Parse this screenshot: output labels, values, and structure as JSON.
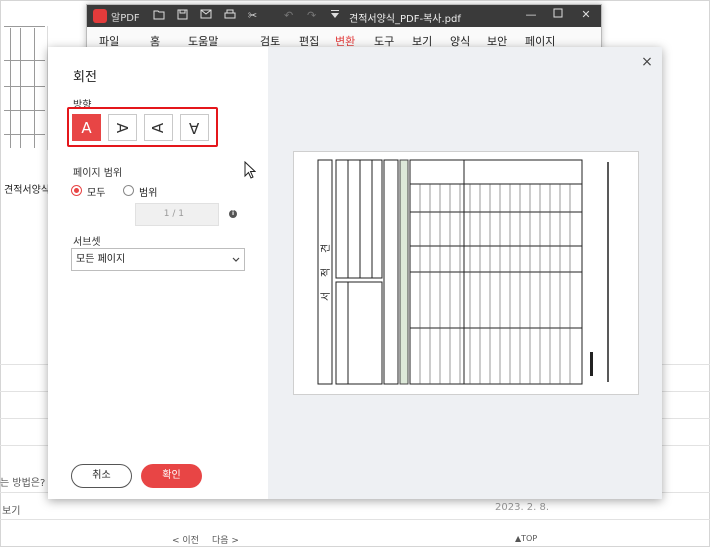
{
  "background": {
    "doc_title": "견적서양식_",
    "question": "는 방법은?",
    "view_label": "보기",
    "date": "2023. 2. 8.",
    "prev_label": "< 이전",
    "next_label": "다음 >",
    "top_label": "▲TOP"
  },
  "app": {
    "name": "알PDF",
    "document_title": "견적서양식_PDF-복사.pdf",
    "menu": [
      "파일",
      "홈",
      "도움말",
      "검토",
      "편집",
      "변환",
      "도구",
      "보기",
      "양식",
      "보안",
      "페이지"
    ],
    "active_menu": "변환"
  },
  "dialog": {
    "title": "회전",
    "direction_label": "방향",
    "directions": [
      "A",
      "A",
      "A",
      "A"
    ],
    "selected_direction": 0,
    "page_range_label": "페이지 범위",
    "range_all": "모두",
    "range_custom": "범위",
    "range_value": "1 / 1",
    "subset_label": "서브셋",
    "subset_value": "모든 페이지",
    "cancel_label": "취소",
    "ok_label": "확인",
    "close_icon": "×"
  },
  "preview": {
    "labels": [
      "견",
      "적",
      "서"
    ]
  },
  "colors": {
    "accent": "#e84545",
    "highlight": "#e4161b",
    "titlebar": "#3a3a3a"
  }
}
